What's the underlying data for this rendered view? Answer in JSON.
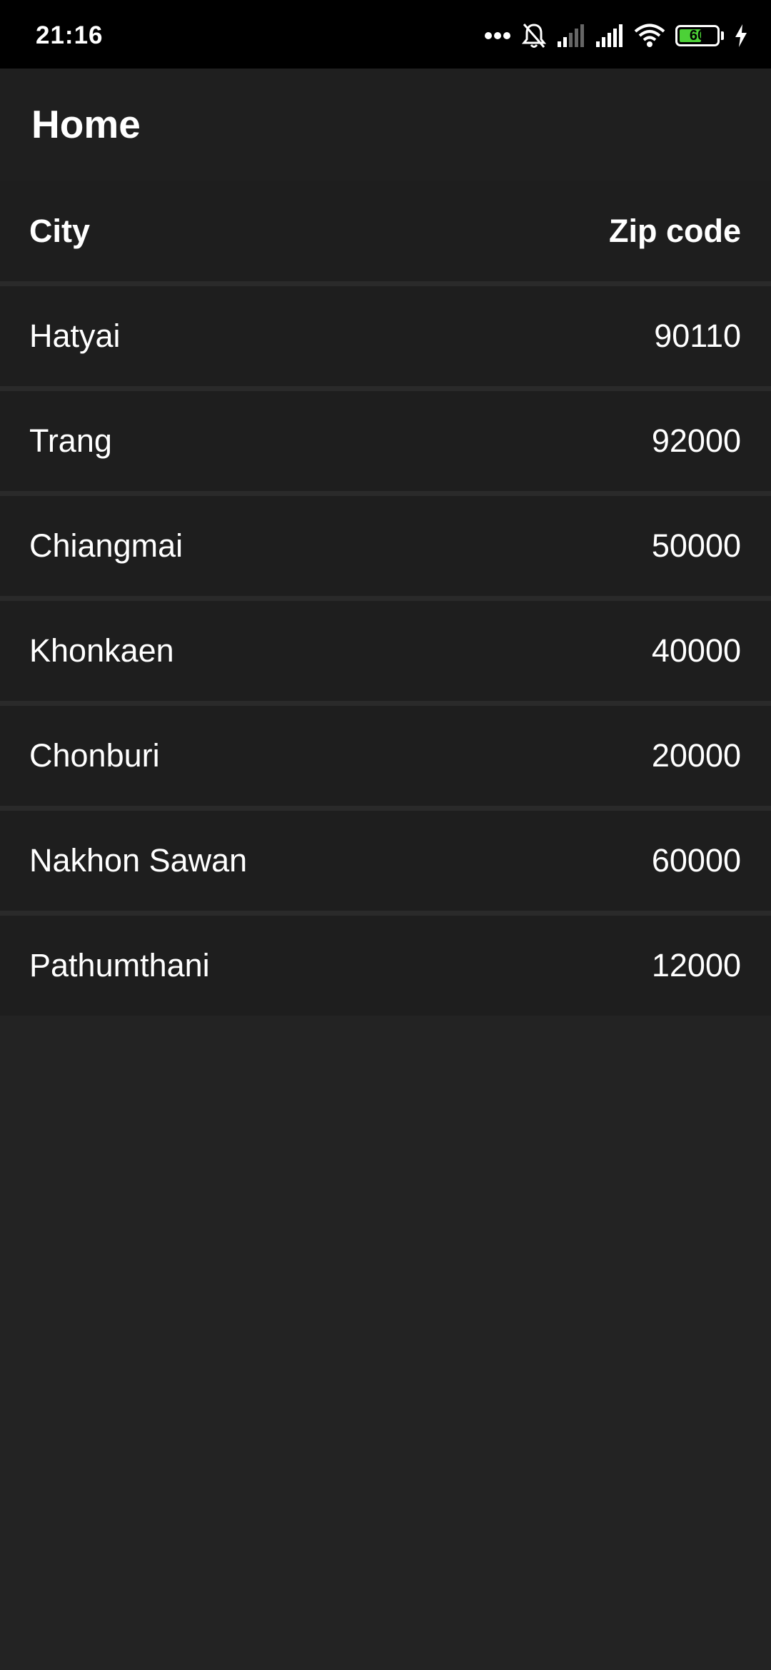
{
  "status_bar": {
    "time": "21:16",
    "battery_level": "60",
    "battery_fraction": 0.6,
    "icons": [
      "more-dots-icon",
      "mute-bell-icon",
      "signal-weak-icon",
      "signal-strong-icon",
      "wifi-icon",
      "battery-icon",
      "charging-bolt-icon"
    ],
    "battery_fill_color": "#4cd137"
  },
  "app_bar": {
    "title": "Home"
  },
  "table": {
    "columns": [
      "City",
      "Zip code"
    ],
    "rows": [
      {
        "city": "Hatyai",
        "zip": "90110"
      },
      {
        "city": "Trang",
        "zip": "92000"
      },
      {
        "city": "Chiangmai",
        "zip": "50000"
      },
      {
        "city": "Khonkaen",
        "zip": "40000"
      },
      {
        "city": "Chonburi",
        "zip": "20000"
      },
      {
        "city": "Nakhon Sawan",
        "zip": "60000"
      },
      {
        "city": "Pathumthani",
        "zip": "12000"
      }
    ]
  }
}
